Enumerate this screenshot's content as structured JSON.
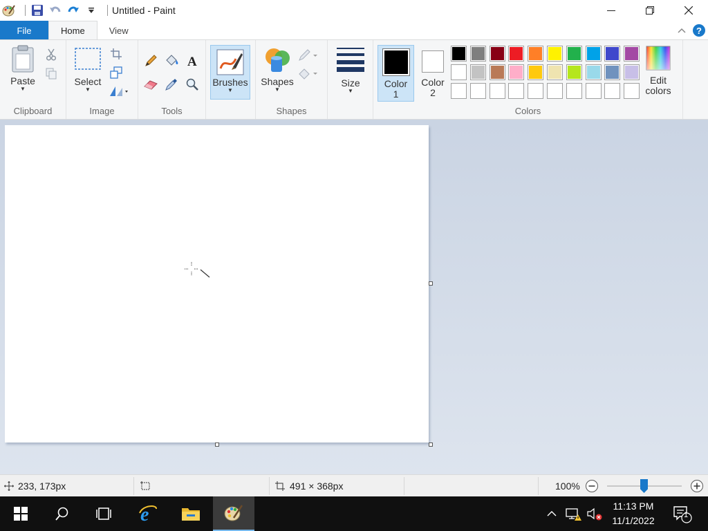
{
  "window": {
    "title": "Untitled - Paint"
  },
  "tabs": {
    "file": "File",
    "home": "Home",
    "view": "View"
  },
  "ribbon": {
    "clipboard": {
      "label": "Clipboard",
      "paste": "Paste"
    },
    "image": {
      "label": "Image",
      "select": "Select"
    },
    "tools": {
      "label": "Tools"
    },
    "brushes": "Brushes",
    "shapes": {
      "label": "Shapes",
      "button": "Shapes"
    },
    "size": "Size",
    "colors": {
      "label": "Colors",
      "color1_line1": "Color",
      "color1_line2": "1",
      "color2_line1": "Color",
      "color2_line2": "2",
      "edit_line1": "Edit",
      "edit_line2": "colors",
      "color1_value": "#000000",
      "color2_value": "#ffffff",
      "palette_row1": [
        "#000000",
        "#7f7f7f",
        "#880015",
        "#ed1c24",
        "#ff7f27",
        "#fff200",
        "#22b14c",
        "#00a2e8",
        "#3f48cc",
        "#a349a4"
      ],
      "palette_row2": [
        "#ffffff",
        "#c3c3c3",
        "#b97a57",
        "#ffaec9",
        "#ffc90e",
        "#efe4b0",
        "#b5e61d",
        "#99d9ea",
        "#7092be",
        "#c8bfe7"
      ]
    }
  },
  "status": {
    "cursor_pos": "233, 173px",
    "canvas_size": "491 × 368px",
    "zoom": "100%"
  },
  "taskbar": {
    "time": "11:13 PM",
    "date": "11/1/2022",
    "notifications": "1"
  }
}
